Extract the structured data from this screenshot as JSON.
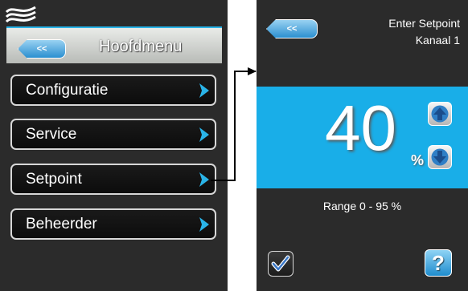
{
  "left_screen": {
    "back_label": "<<",
    "title": "Hoofdmenu",
    "menu": [
      {
        "label": "Configuratie"
      },
      {
        "label": "Service"
      },
      {
        "label": "Setpoint"
      },
      {
        "label": "Beheerder"
      }
    ]
  },
  "right_screen": {
    "back_label": "<<",
    "title": "Enter Setpoint",
    "channel": "Kanaal 1",
    "value": "40",
    "unit": "%",
    "range_text": "Range 0 - 95 %",
    "help_label": "?"
  },
  "colors": {
    "accent": "#19aee8",
    "screen_bg": "#2b2b2b",
    "button_border": "#d7d7d7"
  },
  "icons": [
    "logo-icon",
    "back-arrow-icon",
    "chevron-right-icon",
    "arrow-up-icon",
    "arrow-down-icon",
    "checkmark-icon",
    "help-icon"
  ]
}
